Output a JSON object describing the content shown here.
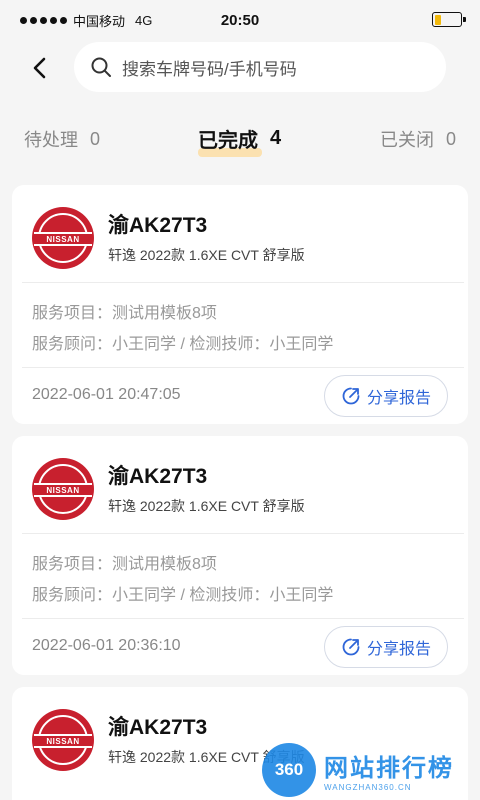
{
  "status_bar": {
    "carrier": "中国移动",
    "network": "4G",
    "time": "20:50",
    "battery_level": 0.25,
    "battery_color": "#f2b90c"
  },
  "header": {
    "back_icon": "chevron-left-icon",
    "search_icon": "search-icon",
    "search_placeholder": "搜索车牌号码/手机号码"
  },
  "tabs": [
    {
      "label": "待处理",
      "count": "0",
      "active": false
    },
    {
      "label": "已完成",
      "count": "4",
      "active": true
    },
    {
      "label": "已关闭",
      "count": "0",
      "active": false
    }
  ],
  "accent_color": "#2f66d8",
  "brand_logo_color": "#c8202e",
  "cards": [
    {
      "logo_text": "NISSAN",
      "plate": "渝AK27T3",
      "model": "轩逸 2022款 1.6XE CVT 舒享版",
      "service_items": "服务项目：测试用模板8项",
      "staff": "服务顾问：小王同学  /  检测技师：小王同学",
      "timestamp": "2022-06-01 20:47:05",
      "share_label": "分享报告"
    },
    {
      "logo_text": "NISSAN",
      "plate": "渝AK27T3",
      "model": "轩逸 2022款 1.6XE CVT 舒享版",
      "service_items": "服务项目：测试用模板8项",
      "staff": "服务顾问：小王同学  /  检测技师：小王同学",
      "timestamp": "2022-06-01 20:36:10",
      "share_label": "分享报告"
    },
    {
      "logo_text": "NISSAN",
      "plate": "渝AK27T3",
      "model": "轩逸 2022款 1.6XE CVT 舒享版"
    }
  ],
  "watermark": {
    "logo_text": "360",
    "title": "网站排行榜",
    "subtitle": "WANGZHAN360.CN"
  }
}
